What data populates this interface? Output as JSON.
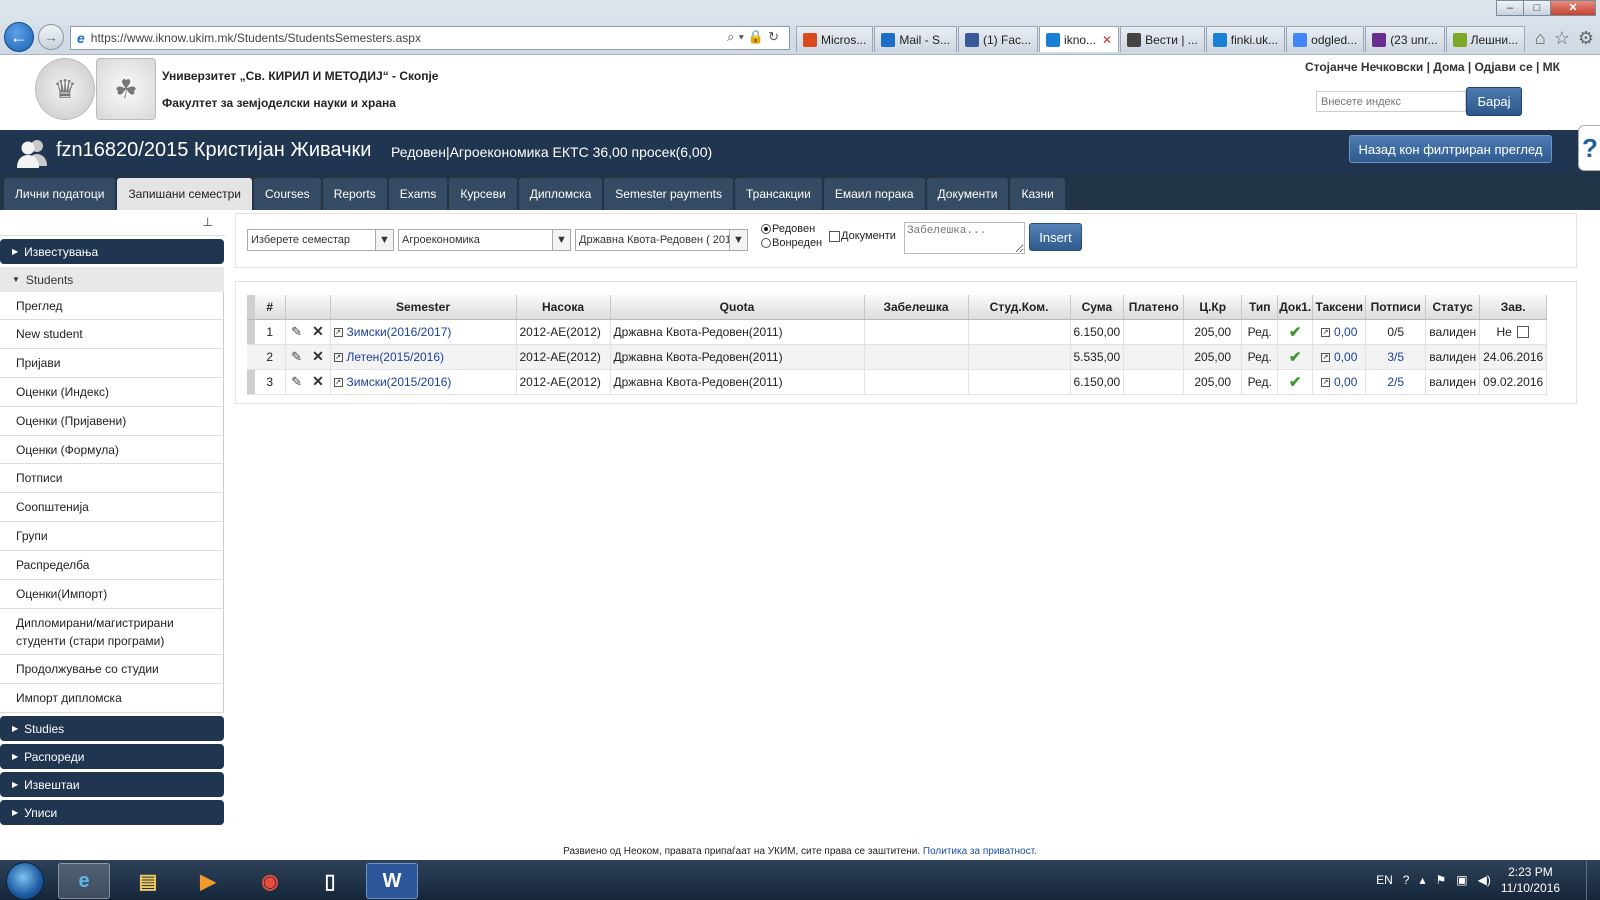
{
  "browser": {
    "url": "https://www.iknow.ukim.mk/Students/StudentsSemesters.aspx",
    "tabs": [
      {
        "label": "Micros...",
        "icon_color": "#d84b1f"
      },
      {
        "label": "Mail - S...",
        "icon_color": "#1e6ec8"
      },
      {
        "label": "(1) Fac...",
        "icon_color": "#3b5998"
      },
      {
        "label": "ikno...",
        "icon_color": "#1c7fd6",
        "active": true
      },
      {
        "label": "Вести | ...",
        "icon_color": "#444444"
      },
      {
        "label": "finki.uk...",
        "icon_color": "#1c7fd6"
      },
      {
        "label": "odgled...",
        "icon_color": "#4285f4"
      },
      {
        "label": "(23 unr...",
        "icon_color": "#6b2d8f"
      },
      {
        "label": "Лешни...",
        "icon_color": "#7fa82a"
      }
    ]
  },
  "header": {
    "university": "Универзитет „Св. КИРИЛ И МЕТОДИЈ“ - Скопје",
    "faculty": "Факултет за земјоделски науки и храна",
    "user_links": "Стојанче Нечковски | Дома | Одјави се | МК",
    "index_placeholder": "Внесете индекс",
    "search_label": "Барај"
  },
  "student": {
    "name": "fzn16820/2015 Кристијан Живачки",
    "info": "Редовен|Агроекономика ЕКТС 36,00 просек(6,00)",
    "back_label": "Назад кон филтриран преглед"
  },
  "main_tabs": [
    "Лични податоци",
    "Запишани семестри",
    "Courses",
    "Reports",
    "Exams",
    "Курсеви",
    "Дипломска",
    "Semester payments",
    "Трансакции",
    "Емаил порака",
    "Документи",
    "Казни"
  ],
  "sidebar": {
    "pin": "⊥",
    "group1": "Известувања",
    "group2": "Students",
    "items": [
      "Преглед",
      "New student",
      "Пријави",
      "Оценки (Индекс)",
      "Оценки (Пријавени)",
      "Оценки (Формула)",
      "Потписи",
      "Соопштенија",
      "Групи",
      "Распределба",
      "Оценки(Импорт)",
      "Дипломирани/магистрирани студенти (стари програми)",
      "Продолжување со студии",
      "Импорт дипломска"
    ],
    "groups_after": [
      "Studies",
      "Распореди",
      "Извештаи",
      "Уписи"
    ]
  },
  "filter": {
    "semester_select": "Изберете семестар",
    "program_select": "Агроекономика",
    "quota_select": "Државна Квота-Редовен ( 201",
    "radio_regular": "Редовен",
    "radio_irregular": "Вонреден",
    "documents_label": "Документи",
    "note_placeholder": "Забелешка...",
    "insert_label": "Insert"
  },
  "grid": {
    "headers": [
      "#",
      "",
      "Semester",
      "Насока",
      "Quota",
      "Забелешка",
      "Студ.Ком.",
      "Сума",
      "Платено",
      "Ц.Кр",
      "Тип",
      "Док1.",
      "Таксени",
      "Потписи",
      "Статус",
      "Зав."
    ],
    "rows": [
      {
        "num": "1",
        "semester": "Зимски(2016/2017)",
        "nasoka": "2012-АЕ(2012)",
        "quota": "Државна Квота-Редовен(2011)",
        "note": "",
        "studkom": "",
        "suma": "6.150,00",
        "plateno": "",
        "ckr": "205,00",
        "tip": "Ред.",
        "taxes": "0,00",
        "signatures": "0/5",
        "status": "валиден",
        "zav": "Не",
        "zav_checkbox": true,
        "signatures_link": false
      },
      {
        "num": "2",
        "semester": "Летен(2015/2016)",
        "nasoka": "2012-АЕ(2012)",
        "quota": "Државна Квота-Редовен(2011)",
        "note": "",
        "studkom": "",
        "suma": "5.535,00",
        "plateno": "",
        "ckr": "205,00",
        "tip": "Ред.",
        "taxes": "0,00",
        "signatures": "3/5",
        "status": "валиден",
        "zav": "24.06.2016",
        "zav_checkbox": false,
        "signatures_link": true
      },
      {
        "num": "3",
        "semester": "Зимски(2015/2016)",
        "nasoka": "2012-АЕ(2012)",
        "quota": "Државна Квота-Редовен(2011)",
        "note": "",
        "studkom": "",
        "suma": "6.150,00",
        "plateno": "",
        "ckr": "205,00",
        "tip": "Ред.",
        "taxes": "0,00",
        "signatures": "2/5",
        "status": "валиден",
        "zav": "09.02.2016",
        "zav_checkbox": false,
        "signatures_link": true
      }
    ]
  },
  "footer": {
    "text": "Развиено од Неоком, правата припаѓаат на УКИМ, сите права се заштитени. ",
    "privacy": "Политика за приватност."
  },
  "taskbar": {
    "lang": "EN",
    "time": "2:23 PM",
    "date": "11/10/2016"
  }
}
